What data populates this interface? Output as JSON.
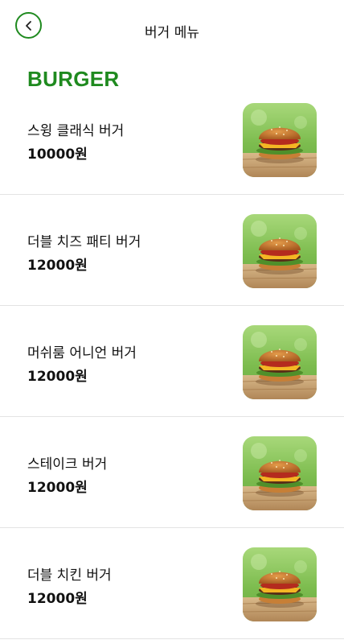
{
  "header": {
    "back_icon": "chevron-left-icon",
    "title": "버거 메뉴"
  },
  "section": {
    "title": "BURGER"
  },
  "colors": {
    "accent": "#1f8a1f",
    "divider": "#e3e3e3"
  },
  "menu": {
    "items": [
      {
        "name": "스윙 클래식 버거",
        "price": "10000원",
        "image": "burger-photo"
      },
      {
        "name": "더블 치즈 패티 버거",
        "price": "12000원",
        "image": "burger-photo"
      },
      {
        "name": "머쉬룸 어니언 버거",
        "price": "12000원",
        "image": "burger-photo"
      },
      {
        "name": "스테이크 버거",
        "price": "12000원",
        "image": "burger-photo"
      },
      {
        "name": "더블 치킨 버거",
        "price": "12000원",
        "image": "burger-photo"
      }
    ]
  }
}
